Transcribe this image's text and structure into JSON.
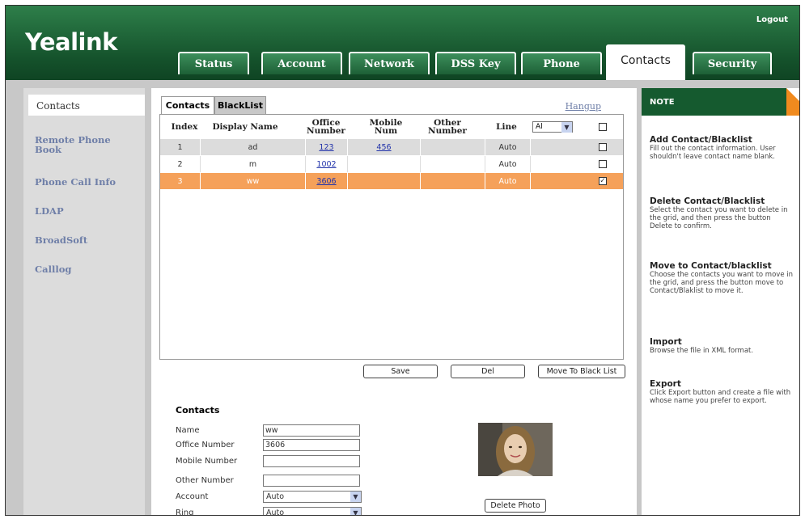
{
  "app": {
    "brand": "Yealink",
    "logout_label": "Logout"
  },
  "tabs": [
    {
      "label": "Status"
    },
    {
      "label": "Account"
    },
    {
      "label": "Network"
    },
    {
      "label": "DSS Key"
    },
    {
      "label": "Phone"
    },
    {
      "label": "Contacts",
      "active": true
    },
    {
      "label": "Security"
    }
  ],
  "sidebar": {
    "items": [
      {
        "label": "Contacts",
        "active": true
      },
      {
        "label": "Remote Phone Book"
      },
      {
        "label": "Phone Call Info"
      },
      {
        "label": "LDAP"
      },
      {
        "label": "BroadSoft"
      },
      {
        "label": "Calllog"
      }
    ]
  },
  "subtabs": [
    {
      "label": "Contacts",
      "active": true
    },
    {
      "label": "BlackList"
    }
  ],
  "hangup_label": "Hangup",
  "grid": {
    "headers": [
      "Index",
      "Display Name",
      "Office Number",
      "Mobile Num",
      "Other Number",
      "Line"
    ],
    "line_filter": "Al",
    "rows": [
      {
        "index": "1",
        "name": "ad",
        "office": "123",
        "mobile": "456",
        "other": "",
        "line": "Auto",
        "checked": false
      },
      {
        "index": "2",
        "name": "m",
        "office": "1002",
        "mobile": "",
        "other": "",
        "line": "Auto",
        "checked": false
      },
      {
        "index": "3",
        "name": "ww",
        "office": "3606",
        "mobile": "",
        "other": "",
        "line": "Auto",
        "checked": true
      }
    ]
  },
  "buttons": {
    "save": "Save",
    "del": "Del",
    "move": "Move To Black List",
    "delete_photo": "Delete Photo"
  },
  "form": {
    "title": "Contacts",
    "name_label": "Name",
    "name_value": "ww",
    "office_label": "Office Number",
    "office_value": "3606",
    "mobile_label": "Mobile Number",
    "mobile_value": "",
    "other_label": "Other Number",
    "other_value": "",
    "account_label": "Account",
    "account_value": "Auto",
    "ring_label": "Ring",
    "ring_value": "Auto"
  },
  "note": {
    "title": "NOTE",
    "sections": [
      {
        "title": "Add Contact/Blacklist",
        "text": "Fill out the contact information. User shouldn't leave contact name blank."
      },
      {
        "title": "Delete Contact/Blacklist",
        "text": "Select the contact you want to delete in the grid, and then press the button Delete to confirm."
      },
      {
        "title": "Move to Contact/blacklist",
        "text": "Choose the contacts you want to move in the grid, and press the button move to Contact/Blaklist to move it."
      },
      {
        "title": "Import",
        "text": "Browse the file in XML format."
      },
      {
        "title": "Export",
        "text": "Click Export button and create a file with whose name you prefer to export."
      }
    ]
  },
  "colors": {
    "header_green": "#15532c",
    "selected_row": "#f5a15a",
    "grid_row": "#dcdcdc",
    "note_accent": "#f08a1e"
  }
}
